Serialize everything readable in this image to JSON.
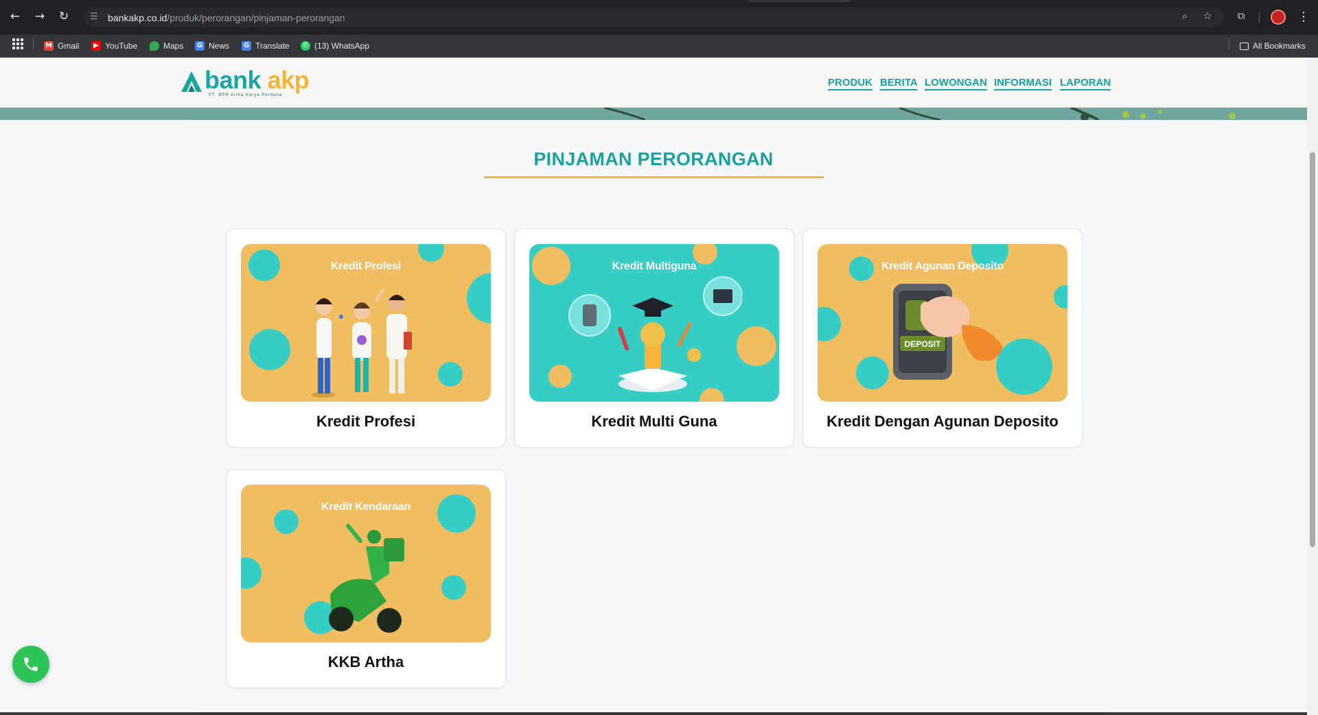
{
  "browser": {
    "url_host": "bankakp.co.id",
    "url_path": "/produk/perorangan/pinjaman-perorangan",
    "bookmarks": [
      {
        "label": "Gmail",
        "icon": "gmail-icon",
        "color": "#ea4335"
      },
      {
        "label": "YouTube",
        "icon": "youtube-icon",
        "color": "#ff0000"
      },
      {
        "label": "Maps",
        "icon": "maps-icon",
        "color": "#34a853"
      },
      {
        "label": "News",
        "icon": "news-icon",
        "color": "#4285f4"
      },
      {
        "label": "Translate",
        "icon": "translate-icon",
        "color": "#4285f4"
      },
      {
        "label": "(13) WhatsApp",
        "icon": "whatsapp-icon",
        "color": "#25d366"
      }
    ],
    "all_bookmarks": "All Bookmarks"
  },
  "site": {
    "logo": {
      "word1": "bank",
      "word2": "akp",
      "subtitle": "PT. BPR Artha Karya Perdana"
    },
    "nav": [
      "PRODUK",
      "BERITA",
      "LOWONGAN",
      "INFORMASI",
      "LAPORAN"
    ],
    "page_title": "PINJAMAN PERORANGAN",
    "products": [
      {
        "label": "Kredit Profesi",
        "image_title": "Kredit Profesi",
        "bg": "orange"
      },
      {
        "label": "Kredit Multi Guna",
        "image_title": "Kredit Multiguna",
        "bg": "teal"
      },
      {
        "label": "Kredit Dengan Agunan Deposito",
        "image_title": "Kredit Agunan Deposito",
        "bg": "orange",
        "badge": "DEPOSIT"
      },
      {
        "label": "KKB Artha",
        "image_title": "Kredit Kendaraan",
        "bg": "orange"
      }
    ]
  },
  "colors": {
    "accent": "#17a2a0",
    "brand_orange": "#f2b53a",
    "card_orange": "#f0bd60",
    "card_teal": "#35cdc4"
  }
}
